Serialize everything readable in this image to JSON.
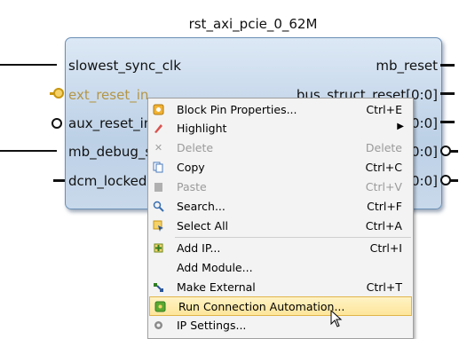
{
  "block": {
    "title": "rst_axi_pcie_0_62M",
    "left_pins": [
      "slowest_sync_clk",
      "ext_reset_in",
      "aux_reset_in",
      "mb_debug_sys_rst",
      "dcm_locked"
    ],
    "right_pins": [
      "mb_reset",
      "bus_struct_reset[0:0]",
      "[0:0]",
      "[0:0]",
      "[0:0]"
    ]
  },
  "menu": {
    "items": [
      {
        "label": "Block Pin Properties...",
        "shortcut": "Ctrl+E",
        "icon": "properties-icon",
        "disabled": false
      },
      {
        "label": "Highlight",
        "shortcut": "",
        "icon": "highlight-icon",
        "disabled": false,
        "submenu": true
      },
      {
        "label": "Delete",
        "shortcut": "Delete",
        "icon": "delete-icon",
        "disabled": true
      },
      {
        "label": "Copy",
        "shortcut": "Ctrl+C",
        "icon": "copy-icon",
        "disabled": false
      },
      {
        "label": "Paste",
        "shortcut": "Ctrl+V",
        "icon": "paste-icon",
        "disabled": true
      },
      {
        "label": "Search...",
        "shortcut": "Ctrl+F",
        "icon": "search-icon",
        "disabled": false
      },
      {
        "label": "Select All",
        "shortcut": "Ctrl+A",
        "icon": "select-all-icon",
        "disabled": false
      },
      {
        "label": "Add IP...",
        "shortcut": "Ctrl+I",
        "icon": "add-ip-icon",
        "disabled": false
      },
      {
        "label": "Add Module...",
        "shortcut": "",
        "icon": "",
        "disabled": false
      },
      {
        "label": "Make External",
        "shortcut": "Ctrl+T",
        "icon": "make-external-icon",
        "disabled": false
      },
      {
        "label": "Run Connection Automation...",
        "shortcut": "",
        "icon": "connection-automation-icon",
        "disabled": false,
        "highlighted": true
      },
      {
        "label": "IP Settings...",
        "shortcut": "",
        "icon": "settings-icon",
        "disabled": false
      }
    ]
  },
  "colors": {
    "block_border": "#6b8fb5",
    "menu_highlight": "#fde59a",
    "gold_pin": "#c8960f"
  }
}
